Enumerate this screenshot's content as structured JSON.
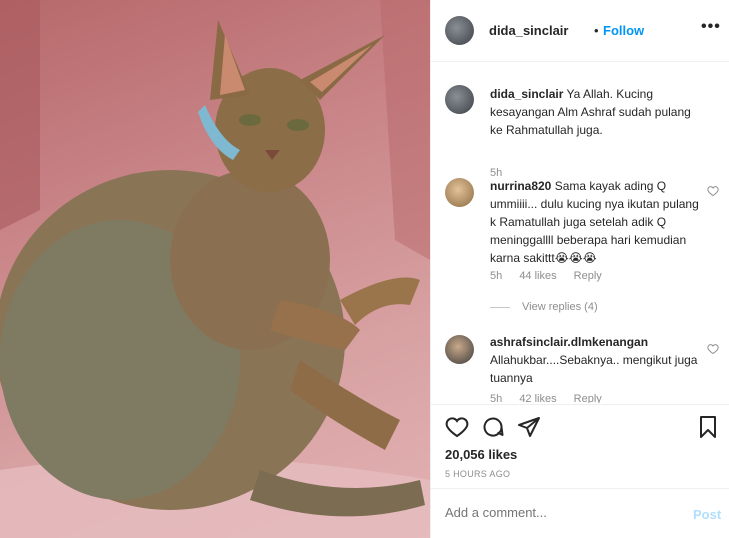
{
  "post": {
    "username": "dida_sinclair",
    "separator": "•",
    "follow_label": "Follow",
    "more_label": "•••",
    "image_alt": "cat-photo"
  },
  "caption": {
    "username": "dida_sinclair",
    "text": "Ya Allah. Kucing kesayangan Alm Ashraf sudah pulang ke Rahmatullah juga.",
    "time": "5h"
  },
  "comments": [
    {
      "username": "nurrina820",
      "text": "Sama kayak ading Q ummiiii... dulu kucing nya ikutan pulang k Ramatullah juga setelah adik Q meninggallll beberapa hari kemudian karna sakittt😭😭😭",
      "time": "5h",
      "likes": "44 likes",
      "reply": "Reply",
      "view_replies": "View replies (4)"
    },
    {
      "username": "ashrafsinclair.dlmkenangan",
      "text": "Allahukbar....Sebaknya.. mengikut juga tuannya",
      "time": "5h",
      "likes": "42 likes",
      "reply": "Reply"
    }
  ],
  "actions": {
    "likes_count": "20,056 likes",
    "timestamp": "5 HOURS AGO"
  },
  "add_comment": {
    "placeholder": "Add a comment...",
    "post_label": "Post"
  },
  "colors": {
    "accent": "#0095f6",
    "muted": "#8e8e8e",
    "post_disabled": "#b2dffc"
  }
}
